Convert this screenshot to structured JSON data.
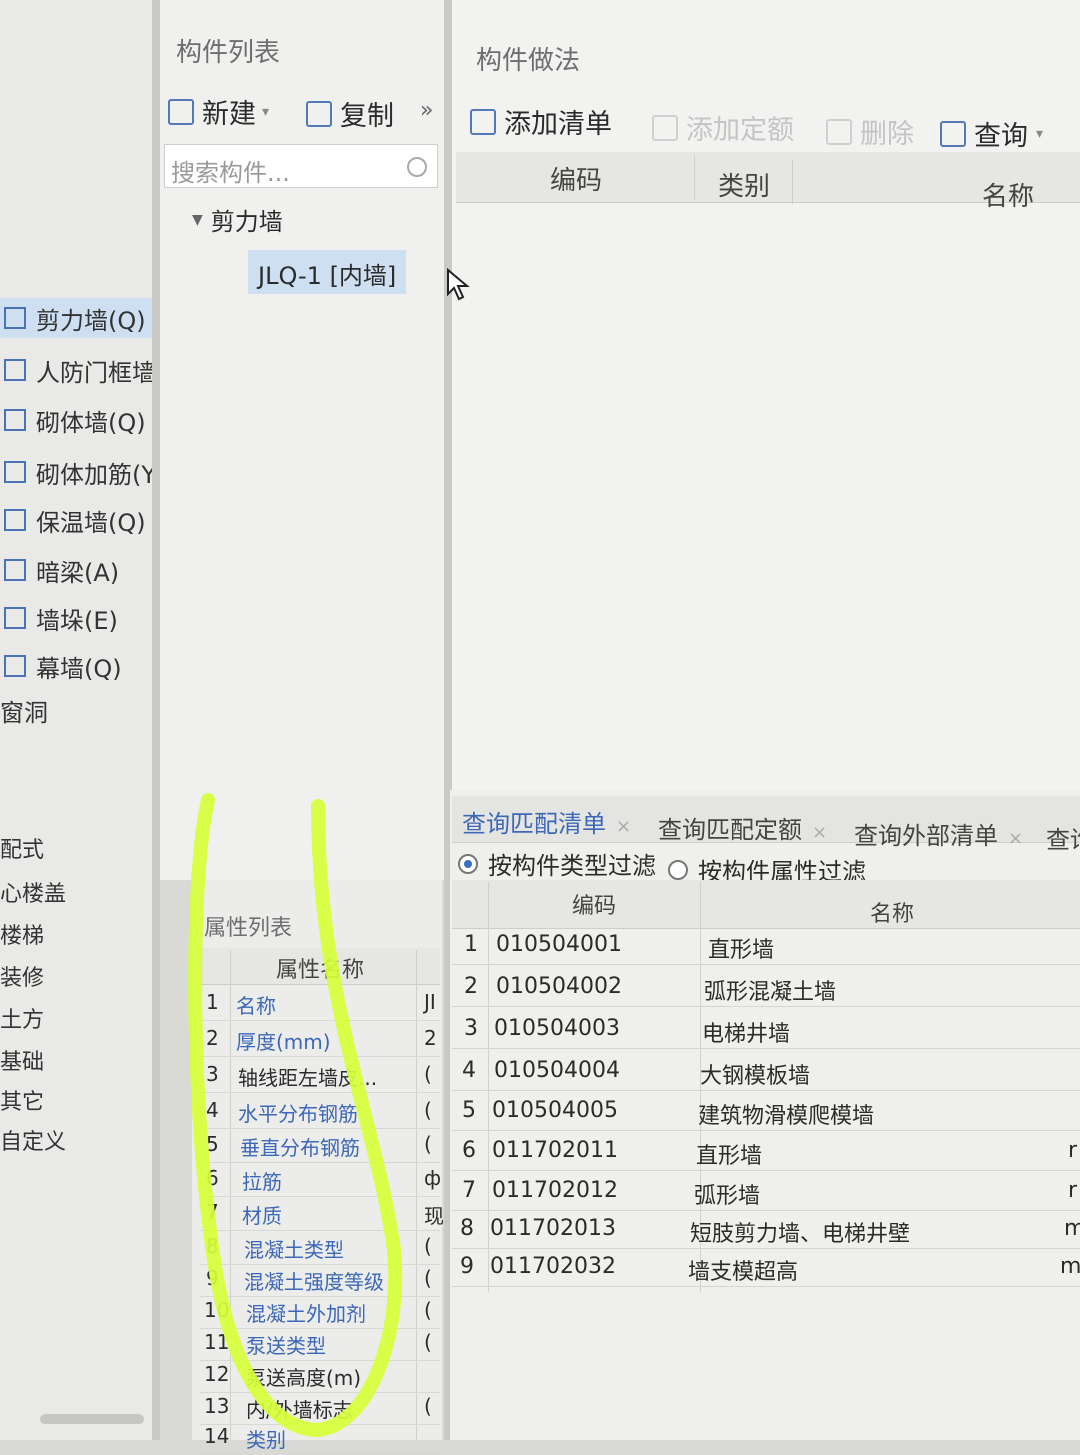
{
  "left_nav": {
    "items": [
      {
        "label": "剪力墙(Q)",
        "active": true
      },
      {
        "label": "人防门框墙"
      },
      {
        "label": "砌体墙(Q)"
      },
      {
        "label": "砌体加筋(Y"
      },
      {
        "label": "保温墙(Q)"
      },
      {
        "label": "暗梁(A)"
      },
      {
        "label": "墙垛(E)"
      },
      {
        "label": "幕墙(Q)"
      },
      {
        "label": "窗洞"
      }
    ],
    "categories": [
      "配式",
      "心楼盖",
      "楼梯",
      "装修",
      "土方",
      "基础",
      "其它",
      "自定义"
    ]
  },
  "component_list": {
    "title": "构件列表",
    "new_label": "新建",
    "copy_label": "复制",
    "more_glyph": "»",
    "search_placeholder": "搜索构件...",
    "tree": {
      "group": "剪力墙",
      "item": "JLQ-1 [内墙]"
    }
  },
  "method_panel": {
    "title": "构件做法",
    "toolbar": {
      "add_list": "添加清单",
      "add_quota": "添加定额",
      "delete": "删除",
      "query": "查询"
    },
    "columns": [
      "编码",
      "类别",
      "名称"
    ]
  },
  "query_panel": {
    "tabs": [
      "查询匹配清单",
      "查询匹配定额",
      "查询外部清单",
      "查询"
    ],
    "filters": [
      {
        "label": "按构件类型过滤",
        "selected": true
      },
      {
        "label": "按构件属性过滤",
        "selected": false
      }
    ],
    "columns": [
      "编码",
      "名称"
    ],
    "rows": [
      {
        "n": "1",
        "code": "010504001",
        "name": "直形墙",
        "extra": ""
      },
      {
        "n": "2",
        "code": "010504002",
        "name": "弧形混凝土墙",
        "extra": ""
      },
      {
        "n": "3",
        "code": "010504003",
        "name": "电梯井墙",
        "extra": ""
      },
      {
        "n": "4",
        "code": "010504004",
        "name": "大钢模板墙",
        "extra": ""
      },
      {
        "n": "5",
        "code": "010504005",
        "name": "建筑物滑模爬模墙",
        "extra": ""
      },
      {
        "n": "6",
        "code": "011702011",
        "name": "直形墙",
        "extra": "r"
      },
      {
        "n": "7",
        "code": "011702012",
        "name": "弧形墙",
        "extra": "r"
      },
      {
        "n": "8",
        "code": "011702013",
        "name": "短肢剪力墙、电梯井壁",
        "extra": "m"
      },
      {
        "n": "9",
        "code": "011702032",
        "name": "墙支模超高",
        "extra": "m"
      }
    ]
  },
  "property_list": {
    "title": "属性列表",
    "column": "属性名称",
    "rows": [
      {
        "n": "1",
        "name": "名称",
        "value": "JI",
        "blue": true
      },
      {
        "n": "2",
        "name": "厚度(mm)",
        "value": "2",
        "blue": true
      },
      {
        "n": "3",
        "name": "轴线距左墙皮...",
        "value": "(",
        "blue": false
      },
      {
        "n": "4",
        "name": "水平分布钢筋",
        "value": "(",
        "blue": true
      },
      {
        "n": "5",
        "name": "垂直分布钢筋",
        "value": "(",
        "blue": true
      },
      {
        "n": "6",
        "name": "拉筋",
        "value": "ф",
        "blue": true
      },
      {
        "n": "7",
        "name": "材质",
        "value": "现",
        "blue": true
      },
      {
        "n": "8",
        "name": "混凝土类型",
        "value": "(",
        "blue": true
      },
      {
        "n": "9",
        "name": "混凝土强度等级",
        "value": "(",
        "blue": true
      },
      {
        "n": "10",
        "name": "混凝土外加剂",
        "value": "(",
        "blue": true
      },
      {
        "n": "11",
        "name": "泵送类型",
        "value": "(",
        "blue": true
      },
      {
        "n": "12",
        "name": "泵送高度(m)",
        "value": "",
        "blue": false
      },
      {
        "n": "13",
        "name": "内/外墙标志",
        "value": "(",
        "blue": false
      },
      {
        "n": "14",
        "name": "类别",
        "value": "",
        "blue": true
      }
    ]
  },
  "colors": {
    "highlight_stroke": "#d7ff3a",
    "accent": "#3d68b8",
    "active_bg": "#cfdff2"
  }
}
